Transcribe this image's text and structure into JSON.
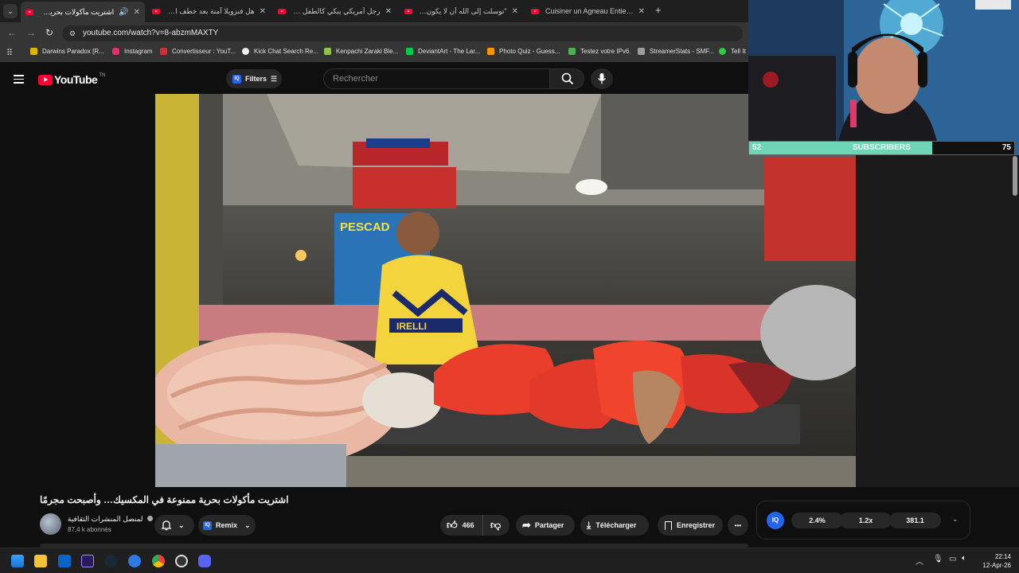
{
  "browser": {
    "tabs": [
      {
        "title": "اشتريت مأكولات بحرية ممنو",
        "active": true
      },
      {
        "title": "هل فنزويلا آمنة بعد خطف الرئيس",
        "active": false
      },
      {
        "title": "رجل أمريكي يبكي كالطفل عندما",
        "active": false
      },
      {
        "title": "\"توسلت إلى الله أن لا يكون الإسلا",
        "active": false
      },
      {
        "title": "Cuisiner un Agneau Entier sous",
        "active": false
      }
    ],
    "new_tab": "+",
    "url": "youtube.com/watch?v=8-abzmMAXTY",
    "bookmarks": [
      {
        "label": "Darwins Paradox [R...",
        "color": "#e0b400"
      },
      {
        "label": "Instagram",
        "color": "#e1306c"
      },
      {
        "label": "Convertisseur : YouT...",
        "color": "#d32f2f"
      },
      {
        "label": "Kick Chat Search Re...",
        "color": "#f0f0f0"
      },
      {
        "label": "Kenpachi Zaraki Ble...",
        "color": "#8bc34a"
      },
      {
        "label": "DeviantArt - The Lar...",
        "color": "#05cc47"
      },
      {
        "label": "Photo Quiz - Guess...",
        "color": "#ff9800"
      },
      {
        "label": "Testez votre IPv6.",
        "color": "#4caf50"
      },
      {
        "label": "StreamerStats - SMF...",
        "color": "#9e9e9e"
      },
      {
        "label": "Tell It",
        "color": "#2ecc40"
      }
    ]
  },
  "youtube": {
    "logo": "YouTube",
    "country": "TN",
    "filters_label": "Filters",
    "search_placeholder": "Rechercher"
  },
  "stream_overlay": {
    "subscribers_label": "SUBSCRIBERS",
    "current": "52",
    "goal": "75",
    "progress": 0.69
  },
  "video": {
    "title": "اشتريت مأكولات بحرية ممنوعة في المكسيك… وأصبحت مجرمًا",
    "channel": "لمنصل المنشرات الثقافية",
    "subscribers": "87,4 k abonnés",
    "remix": "Remix",
    "likes": "466",
    "share": "Partager",
    "download": "Télécharger",
    "save": "Enregistrer",
    "more": "•••"
  },
  "iq_widget": {
    "badge": "IQ",
    "stat1": "2.4%",
    "stat2": "1.2x",
    "stat3": "381.1"
  },
  "taskbar": {
    "time": "22:14",
    "date": "12-Apr-26"
  },
  "colors": {
    "accent_red": "#ff0033",
    "sub_bar": "#6ed6b7",
    "iq_blue": "#2563eb"
  }
}
